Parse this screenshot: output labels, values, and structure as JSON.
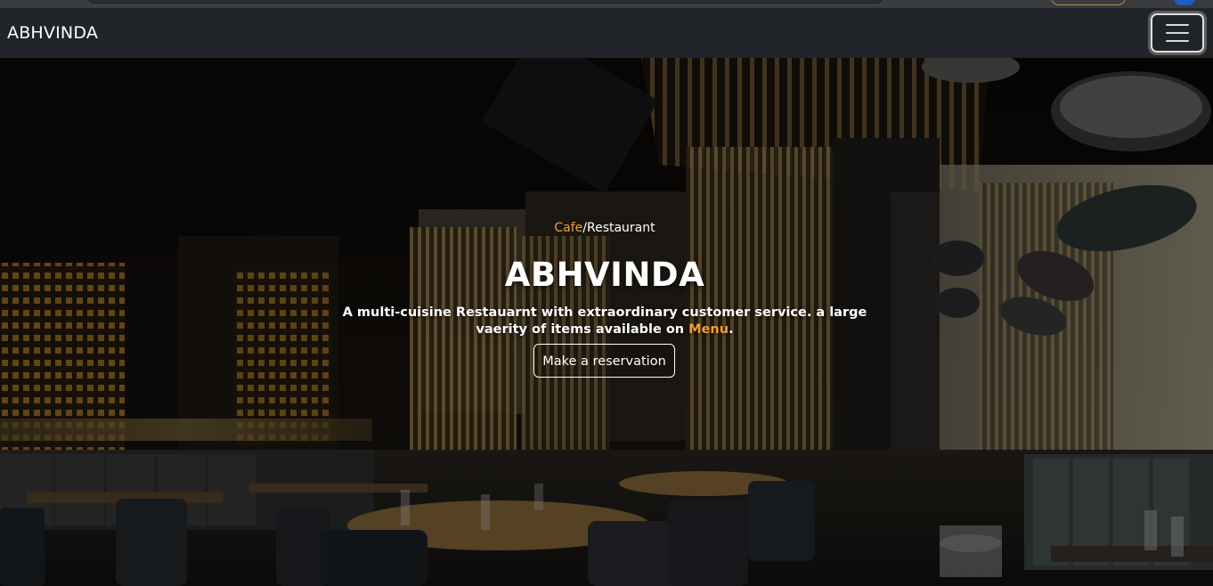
{
  "navbar": {
    "brand": "ABHVINDA",
    "toggler_icon": "hamburger-menu-icon"
  },
  "hero": {
    "tagline_accent": "Cafe",
    "tagline_rest": "/Restaurant",
    "title": "ABHVINDA",
    "description_part1": "A multi-cuisine Restauarnt with extraordinary customer service. a large vaerity of items available on ",
    "menu_link": "Menu",
    "description_end": ".",
    "reservation_button": "Make a reservation"
  },
  "colors": {
    "navbar_bg": "#212529",
    "accent": "#f0a030",
    "text": "#ffffff"
  }
}
